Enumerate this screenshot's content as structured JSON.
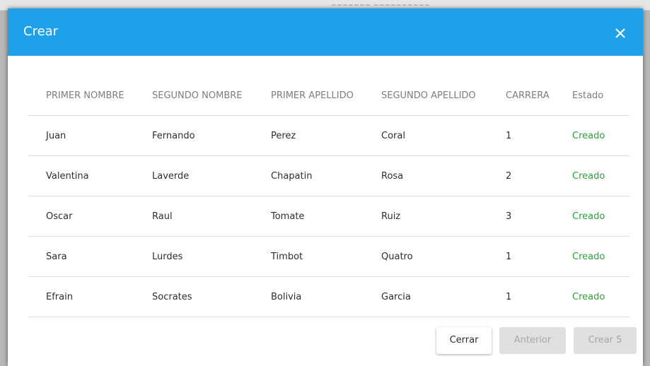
{
  "background_window": {
    "scribble": "~~~~~~~ ~~~~~~~~~~"
  },
  "modal": {
    "title": "Crear",
    "header_color": "#1ea1e8",
    "close_icon": "close-icon"
  },
  "table": {
    "columns": [
      "PRIMER NOMBRE",
      "SEGUNDO NOMBRE",
      "PRIMER APELLIDO",
      "SEGUNDO APELLIDO",
      "CARRERA",
      "Estado"
    ],
    "rows": [
      [
        "Juan",
        "Fernando",
        "Perez",
        "Coral",
        "1",
        "Creado"
      ],
      [
        "Valentina",
        "Laverde",
        "Chapatin",
        "Rosa",
        "2",
        "Creado"
      ],
      [
        "Oscar",
        "Raul",
        "Tomate",
        "Ruiz",
        "3",
        "Creado"
      ],
      [
        "Sara",
        "Lurdes",
        "Timbot",
        "Quatro",
        "1",
        "Creado"
      ],
      [
        "Efrain",
        "Socrates",
        "Bolivia",
        "Garcia",
        "1",
        "Creado"
      ]
    ],
    "status_color": "#2ea03a"
  },
  "footer": {
    "cerrar_label": "Cerrar",
    "anterior_label": "Anterior",
    "crear_label": "Crear 5"
  }
}
